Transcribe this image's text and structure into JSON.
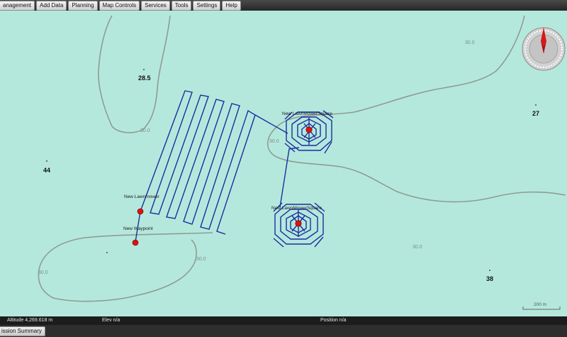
{
  "menubar": {
    "items": [
      {
        "label": "anagement"
      },
      {
        "label": "Add Data"
      },
      {
        "label": "Planning"
      },
      {
        "label": "Map Controls"
      },
      {
        "label": "Services"
      },
      {
        "label": "Tools"
      },
      {
        "label": "Settings"
      },
      {
        "label": "Help"
      }
    ]
  },
  "map": {
    "depth_soundings": [
      "28.5",
      "44",
      "27",
      "38"
    ],
    "contour_labels": [
      "30.0",
      "30.0",
      "30.0",
      "30.0",
      "30.0",
      "30.0"
    ],
    "waypoints": [
      {
        "label": "New Lawnmower"
      },
      {
        "label": "New Waypoint"
      },
      {
        "label": "New LawnMowerSquare"
      },
      {
        "label": "New LawnMowerSquare"
      }
    ],
    "scale_bar": {
      "label": "200 m"
    },
    "colors": {
      "water": "#b5e8dc",
      "track": "#1a2ea0",
      "waypoint": "#e01010",
      "contour": "#8e9c94"
    }
  },
  "statusbar": {
    "altitude": "Altitude 4,269.618 m",
    "elevation": "Elev n/a",
    "position": "Position n/a"
  },
  "bottombar": {
    "tab_label": "ission Summary"
  }
}
